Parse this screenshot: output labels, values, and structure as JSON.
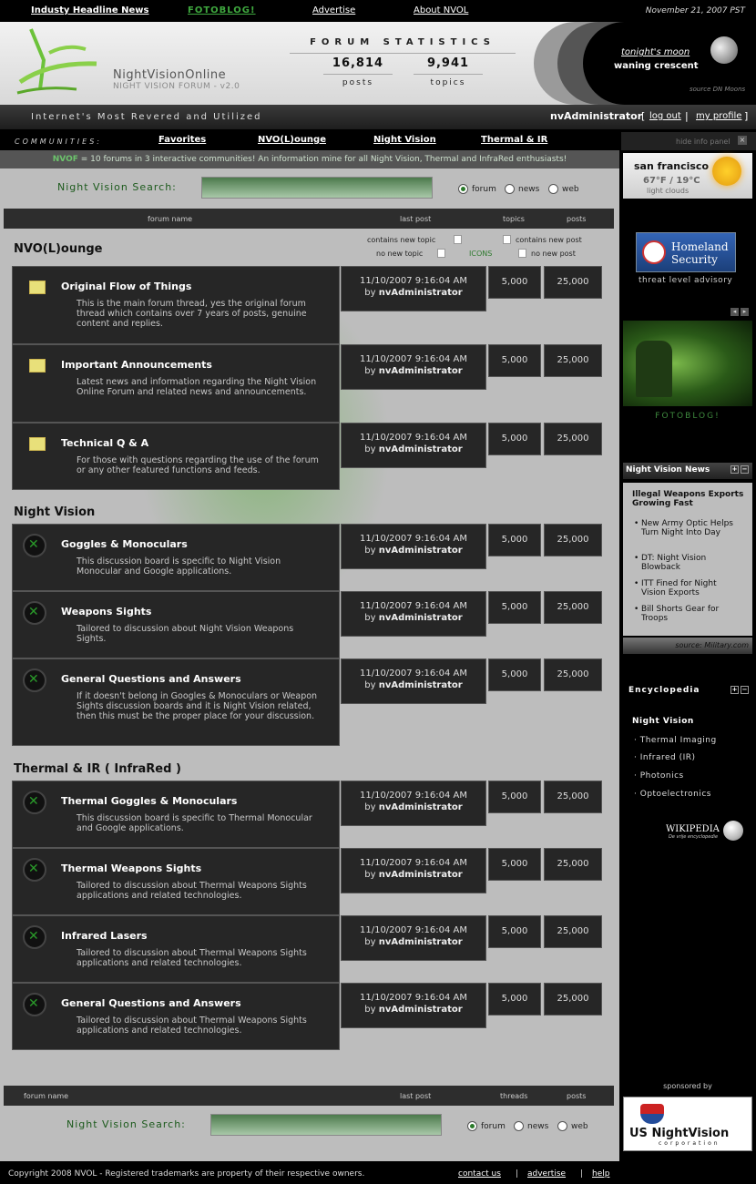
{
  "topbar": {
    "industry": "Industy Headline News",
    "fotoblog": "FOTOBLOG!",
    "advertise": "Advertise",
    "about": "About NVOL",
    "date": "November 21, 2007 PST"
  },
  "header": {
    "brand": "NightVisionOnline",
    "brand_sub": "NIGHT VISION FORUM - v2.0",
    "stats_title": "FORUM STATISTICS",
    "posts_num": "16,814",
    "posts_lbl": "posts",
    "topics_num": "9,941",
    "topics_lbl": "topics",
    "tonight": "tonight's moon",
    "moon_phase": "waning crescent",
    "moon_source": "source DN Moons"
  },
  "tagbar": {
    "tagline": "Internet's Most Revered and Utilized",
    "user": "nvAdministrator",
    "logout": "log out",
    "profile": "my profile",
    "sep1": "[",
    "sep2": "|",
    "sep3": "]"
  },
  "communities": {
    "label": "COMMUNITIES:",
    "links": [
      "Favorites",
      "NVO(L)ounge",
      "Night Vision",
      "Thermal & IR"
    ]
  },
  "info": {
    "brand": "NVOF",
    "text": " = 10 forums in 3 interactive communities! An information mine for all Night Vision, Thermal and InfraRed enthusiasts!"
  },
  "search": {
    "label": "Night Vision Search:",
    "opts": [
      "forum",
      "news",
      "web"
    ]
  },
  "table_head": {
    "name": "forum name",
    "last": "last post",
    "topics": "topics",
    "posts": "posts"
  },
  "table_foot": {
    "name": "forum name",
    "last": "last post",
    "threads": "threads",
    "posts": "posts"
  },
  "legend": {
    "new_topic": "contains new topic",
    "new_post": "contains new post",
    "no_topic": "no new topic",
    "icons": "ICONS",
    "no_post": "no new post"
  },
  "sections": [
    {
      "title": "NVO(L)ounge",
      "forums": [
        {
          "name": "Original Flow of Things",
          "desc": "This is the main forum thread, yes the original forum thread which contains over 7 years of posts, genuine content and replies.",
          "date": "11/10/2007 9:16:04 AM",
          "by": "by",
          "user": "nvAdministrator",
          "topics": "5,000",
          "posts": "25,000"
        },
        {
          "name": "Important Announcements",
          "desc": "Latest news and information regarding the Night Vision Online Forum and related  news and announcements.",
          "date": "11/10/2007 9:16:04 AM",
          "by": "by",
          "user": "nvAdministrator",
          "topics": "5,000",
          "posts": "25,000"
        },
        {
          "name": "Technical Q & A",
          "desc": "For those with questions regarding the use of the forum or any other featured functions and feeds.",
          "date": "11/10/2007 9:16:04 AM",
          "by": "by",
          "user": "nvAdministrator",
          "topics": "5,000",
          "posts": "25,000"
        }
      ]
    },
    {
      "title": "Night Vision",
      "forums": [
        {
          "name": "Goggles & Monoculars",
          "desc": "This discussion board is specific to Night Vision Monocular and Google applications.",
          "date": "11/10/2007 9:16:04 AM",
          "by": "by",
          "user": "nvAdministrator",
          "topics": "5,000",
          "posts": "25,000"
        },
        {
          "name": "Weapons Sights",
          "desc": "Tailored to discussion about Night Vision Weapons Sights.",
          "date": "11/10/2007 9:16:04 AM",
          "by": "by",
          "user": "nvAdministrator",
          "topics": "5,000",
          "posts": "25,000"
        },
        {
          "name": "General Questions and Answers",
          "desc": "If it doesn't belong in Googles & Monoculars or Weapon Sights discussion boards and it is Night Vision related, then this must be the proper place for your discussion.",
          "date": "11/10/2007 9:16:04 AM",
          "by": "by",
          "user": "nvAdministrator",
          "topics": "5,000",
          "posts": "25,000"
        }
      ]
    },
    {
      "title": "Thermal & IR ( InfraRed )",
      "forums": [
        {
          "name": "Thermal Goggles & Monoculars",
          "desc": "This discussion board is specific to Thermal Monocular and Google applications.",
          "date": "11/10/2007 9:16:04 AM",
          "by": "by",
          "user": "nvAdministrator",
          "topics": "5,000",
          "posts": "25,000"
        },
        {
          "name": "Thermal Weapons Sights",
          "desc": "Tailored to discussion about Thermal Weapons Sights applications and related technologies.",
          "date": "11/10/2007 9:16:04 AM",
          "by": "by",
          "user": "nvAdministrator",
          "topics": "5,000",
          "posts": "25,000"
        },
        {
          "name": "Infrared Lasers",
          "desc": "Tailored to discussion about Thermal Weapons Sights applications and related technologies.",
          "date": "11/10/2007 9:16:04 AM",
          "by": "by",
          "user": "nvAdministrator",
          "topics": "5,000",
          "posts": "25,000"
        },
        {
          "name": "General Questions and Answers",
          "desc": "Tailored to discussion about Thermal Weapons Sights applications and related technologies.",
          "date": "11/10/2007 9:16:04 AM",
          "by": "by",
          "user": "nvAdministrator",
          "topics": "5,000",
          "posts": "25,000"
        }
      ]
    }
  ],
  "sidebar": {
    "hide": "hide info panel",
    "city": "san francisco",
    "temp": "67°F / 19°C",
    "cond": "light clouds",
    "hs1": "Homeland",
    "hs2": "Security",
    "threat": "threat level advisory",
    "fotoblog": "FOTOBLOG!",
    "news_title": "Night Vision News",
    "news_head": "Illegal Weapons Exports Growing Fast",
    "news": [
      "New Army Optic Helps Turn Night Into Day",
      "DT: Night Vision Blowback",
      "ITT Fined for Night Vision Exports",
      "Bill Shorts Gear for Troops"
    ],
    "news_src": "source: Military.com",
    "enc_title": "Encyclopedia",
    "enc_main": "Night Vision",
    "enc_items": [
      "Thermal Imaging",
      "Infrared (IR)",
      "Photonics",
      "Optoelectronics"
    ],
    "wiki": "WIKIPEDIA",
    "wiki_sub": "De vrije encyclopedie",
    "sponsored": "sponsored by",
    "sponsor_name": "US NightVision",
    "sponsor_sub": "corporation"
  },
  "footer": {
    "copy": "Copyright 2008 NVOL - Registered trademarks are property of their respective owners.",
    "contact": "contact us",
    "advertise": "advertise",
    "help": "help"
  }
}
